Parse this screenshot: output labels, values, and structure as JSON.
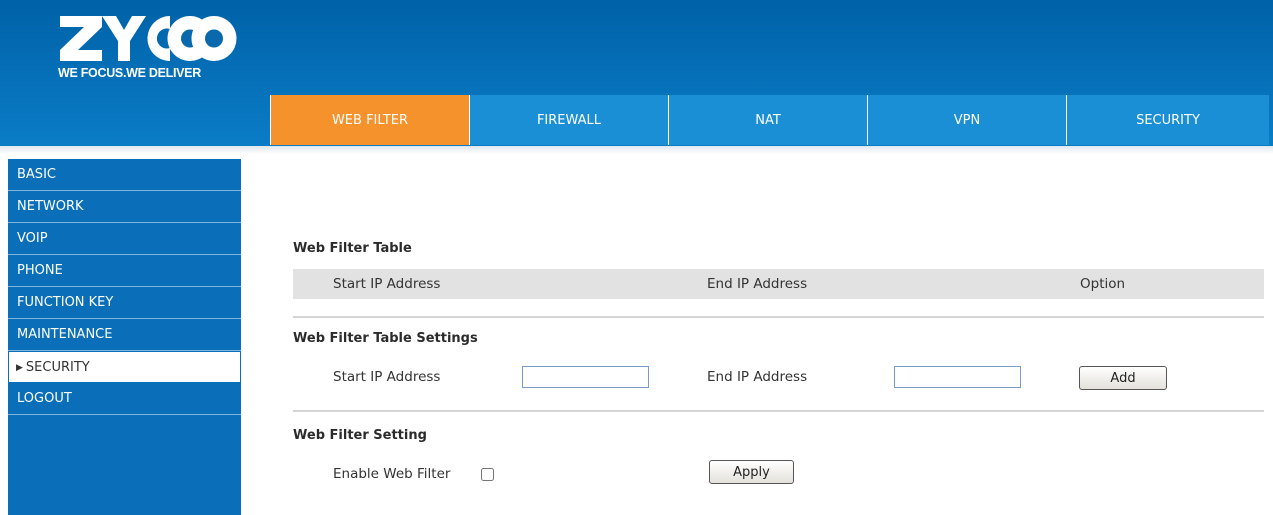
{
  "brand": {
    "logo_text": "ZYCOO",
    "slogan": "WE FOCUS.WE DELIVER"
  },
  "colors": {
    "header_blue": "#0a70bb",
    "tab_blue": "#1b8fd6",
    "tab_active": "#f5922b",
    "sidebar_blue": "#0a6fb8"
  },
  "tabs": [
    {
      "label": "WEB FILTER",
      "active": true
    },
    {
      "label": "FIREWALL",
      "active": false
    },
    {
      "label": "NAT",
      "active": false
    },
    {
      "label": "VPN",
      "active": false
    },
    {
      "label": "SECURITY",
      "active": false
    }
  ],
  "sidebar": {
    "items": [
      {
        "label": "BASIC"
      },
      {
        "label": "NETWORK"
      },
      {
        "label": "VOIP"
      },
      {
        "label": "PHONE"
      },
      {
        "label": "FUNCTION KEY"
      },
      {
        "label": "MAINTENANCE"
      },
      {
        "label": "SECURITY",
        "active": true,
        "marker_icon": "triangle-right-icon"
      },
      {
        "label": "LOGOUT"
      }
    ]
  },
  "web_filter_table": {
    "title": "Web Filter Table",
    "columns": [
      "Start IP Address",
      "End IP Address",
      "Option"
    ],
    "rows": []
  },
  "table_settings": {
    "title": "Web Filter Table Settings",
    "start_label": "Start IP Address",
    "start_value": "",
    "end_label": "End IP Address",
    "end_value": "",
    "add_label": "Add"
  },
  "filter_setting": {
    "title": "Web Filter Setting",
    "enable_label": "Enable Web Filter",
    "enabled": false,
    "apply_label": "Apply"
  }
}
